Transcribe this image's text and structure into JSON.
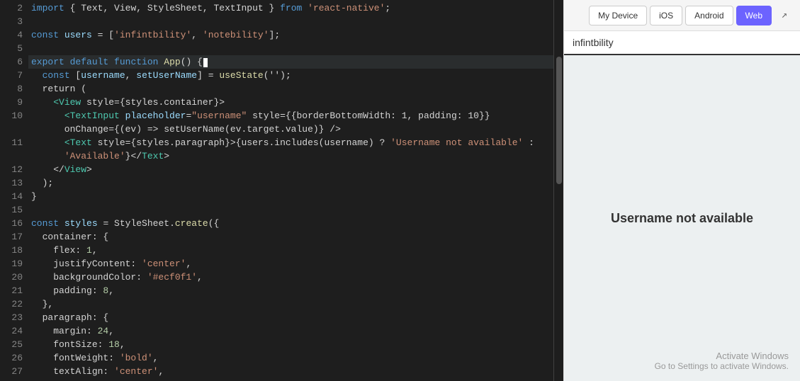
{
  "editor": {
    "lines": [
      {
        "num": 2,
        "tokens": [
          {
            "text": "import",
            "cls": "kw"
          },
          {
            "text": " { ",
            "cls": "plain"
          },
          {
            "text": "Text",
            "cls": "plain"
          },
          {
            "text": ", ",
            "cls": "plain"
          },
          {
            "text": "View",
            "cls": "plain"
          },
          {
            "text": ", ",
            "cls": "plain"
          },
          {
            "text": "StyleSheet",
            "cls": "plain"
          },
          {
            "text": ", ",
            "cls": "plain"
          },
          {
            "text": "TextInput",
            "cls": "plain"
          },
          {
            "text": " } ",
            "cls": "plain"
          },
          {
            "text": "from",
            "cls": "kw"
          },
          {
            "text": " ",
            "cls": "plain"
          },
          {
            "text": "'react-native'",
            "cls": "str"
          },
          {
            "text": ";",
            "cls": "plain"
          }
        ]
      },
      {
        "num": 3,
        "tokens": []
      },
      {
        "num": 4,
        "tokens": [
          {
            "text": "const",
            "cls": "kw"
          },
          {
            "text": " ",
            "cls": "plain"
          },
          {
            "text": "users",
            "cls": "var"
          },
          {
            "text": " = [",
            "cls": "plain"
          },
          {
            "text": "'infintbility'",
            "cls": "str"
          },
          {
            "text": ", ",
            "cls": "plain"
          },
          {
            "text": "'notebility'",
            "cls": "str"
          },
          {
            "text": "];",
            "cls": "plain"
          }
        ]
      },
      {
        "num": 5,
        "tokens": []
      },
      {
        "num": 6,
        "tokens": [
          {
            "text": "export",
            "cls": "kw"
          },
          {
            "text": " ",
            "cls": "plain"
          },
          {
            "text": "default",
            "cls": "kw"
          },
          {
            "text": " ",
            "cls": "plain"
          },
          {
            "text": "function",
            "cls": "kw"
          },
          {
            "text": " ",
            "cls": "plain"
          },
          {
            "text": "App",
            "cls": "fn"
          },
          {
            "text": "() {",
            "cls": "plain"
          }
        ],
        "active": true
      },
      {
        "num": 7,
        "tokens": [
          {
            "text": "  const [",
            "cls": "plain"
          },
          {
            "text": "username",
            "cls": "var"
          },
          {
            "text": ", ",
            "cls": "plain"
          },
          {
            "text": "setUserName",
            "cls": "var"
          },
          {
            "text": "] = ",
            "cls": "plain"
          },
          {
            "text": "useState",
            "cls": "fn"
          },
          {
            "text": "('');",
            "cls": "plain"
          }
        ]
      },
      {
        "num": 8,
        "tokens": [
          {
            "text": "  return (",
            "cls": "plain"
          }
        ]
      },
      {
        "num": 9,
        "tokens": [
          {
            "text": "    ",
            "cls": "plain"
          },
          {
            "text": "<View",
            "cls": "jsx-tag"
          },
          {
            "text": " style={styles.container}>",
            "cls": "plain"
          }
        ]
      },
      {
        "num": 10,
        "tokens": [
          {
            "text": "      ",
            "cls": "plain"
          },
          {
            "text": "<TextInput",
            "cls": "jsx-tag"
          },
          {
            "text": " ",
            "cls": "plain"
          },
          {
            "text": "placeholder",
            "cls": "jsx-attr"
          },
          {
            "text": "=",
            "cls": "plain"
          },
          {
            "text": "\"username\"",
            "cls": "str"
          },
          {
            "text": " style={{borderBottomWidth: 1, padding: 10}}",
            "cls": "plain"
          }
        ]
      },
      {
        "num": 10,
        "tokens": [
          {
            "text": "      onChange={(ev) => setUserName(ev.target.value)} />",
            "cls": "plain"
          }
        ]
      },
      {
        "num": 11,
        "tokens": [
          {
            "text": "      ",
            "cls": "plain"
          },
          {
            "text": "<Text",
            "cls": "jsx-tag"
          },
          {
            "text": " style={styles.paragraph}>{users.includes(username) ? ",
            "cls": "plain"
          },
          {
            "text": "'Username not available'",
            "cls": "str"
          },
          {
            "text": " :",
            "cls": "plain"
          }
        ]
      },
      {
        "num": 11,
        "tokens": [
          {
            "text": "      ",
            "cls": "plain"
          },
          {
            "text": "'Available'",
            "cls": "str"
          },
          {
            "text": "}</",
            "cls": "plain"
          },
          {
            "text": "Text",
            "cls": "jsx-tag"
          },
          {
            "text": ">",
            "cls": "plain"
          }
        ]
      },
      {
        "num": 12,
        "tokens": [
          {
            "text": "    </",
            "cls": "plain"
          },
          {
            "text": "View",
            "cls": "jsx-tag"
          },
          {
            "text": ">",
            "cls": "plain"
          }
        ]
      },
      {
        "num": 13,
        "tokens": [
          {
            "text": "  );",
            "cls": "plain"
          }
        ]
      },
      {
        "num": 14,
        "tokens": [
          {
            "text": "}",
            "cls": "plain"
          }
        ]
      },
      {
        "num": 15,
        "tokens": []
      },
      {
        "num": 16,
        "tokens": [
          {
            "text": "const",
            "cls": "kw"
          },
          {
            "text": " ",
            "cls": "plain"
          },
          {
            "text": "styles",
            "cls": "var"
          },
          {
            "text": " = ",
            "cls": "plain"
          },
          {
            "text": "StyleSheet",
            "cls": "plain"
          },
          {
            "text": ".",
            "cls": "plain"
          },
          {
            "text": "create",
            "cls": "fn"
          },
          {
            "text": "({",
            "cls": "plain"
          }
        ]
      },
      {
        "num": 17,
        "tokens": [
          {
            "text": "  container: {",
            "cls": "plain"
          }
        ]
      },
      {
        "num": 18,
        "tokens": [
          {
            "text": "    flex: ",
            "cls": "plain"
          },
          {
            "text": "1",
            "cls": "num"
          },
          {
            "text": ",",
            "cls": "plain"
          }
        ]
      },
      {
        "num": 19,
        "tokens": [
          {
            "text": "    justifyContent: ",
            "cls": "plain"
          },
          {
            "text": "'center'",
            "cls": "str"
          },
          {
            "text": ",",
            "cls": "plain"
          }
        ]
      },
      {
        "num": 20,
        "tokens": [
          {
            "text": "    backgroundColor: ",
            "cls": "plain"
          },
          {
            "text": "'#ecf0f1'",
            "cls": "str"
          },
          {
            "text": ",",
            "cls": "plain"
          }
        ]
      },
      {
        "num": 21,
        "tokens": [
          {
            "text": "    padding: ",
            "cls": "plain"
          },
          {
            "text": "8",
            "cls": "num"
          },
          {
            "text": ",",
            "cls": "plain"
          }
        ]
      },
      {
        "num": 22,
        "tokens": [
          {
            "text": "  },",
            "cls": "plain"
          }
        ]
      },
      {
        "num": 23,
        "tokens": [
          {
            "text": "  paragraph: {",
            "cls": "plain"
          }
        ]
      },
      {
        "num": 24,
        "tokens": [
          {
            "text": "    margin: ",
            "cls": "plain"
          },
          {
            "text": "24",
            "cls": "num"
          },
          {
            "text": ",",
            "cls": "plain"
          }
        ]
      },
      {
        "num": 25,
        "tokens": [
          {
            "text": "    fontSize: ",
            "cls": "plain"
          },
          {
            "text": "18",
            "cls": "num"
          },
          {
            "text": ",",
            "cls": "plain"
          }
        ]
      },
      {
        "num": 26,
        "tokens": [
          {
            "text": "    fontWeight: ",
            "cls": "plain"
          },
          {
            "text": "'bold'",
            "cls": "str"
          },
          {
            "text": ",",
            "cls": "plain"
          }
        ]
      },
      {
        "num": 27,
        "tokens": [
          {
            "text": "    textAlign: ",
            "cls": "plain"
          },
          {
            "text": "'center'",
            "cls": "str"
          },
          {
            "text": ",",
            "cls": "plain"
          }
        ]
      }
    ]
  },
  "toolbar": {
    "buttons": [
      {
        "label": "My Device",
        "active": false
      },
      {
        "label": "iOS",
        "active": false
      },
      {
        "label": "Android",
        "active": false
      },
      {
        "label": "Web",
        "active": true
      }
    ],
    "external_link_icon": "↗"
  },
  "preview": {
    "input_value": "infintbility",
    "message": "Username not available",
    "activate_title": "Activate Windows",
    "activate_sub": "Go to Settings to activate Windows."
  }
}
